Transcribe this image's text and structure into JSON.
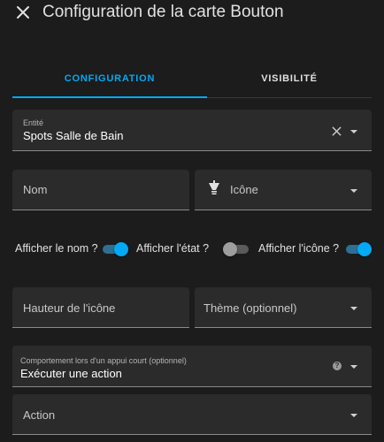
{
  "header": {
    "title": "Configuration de la carte Bouton",
    "close_icon": "close-icon"
  },
  "tabs": [
    {
      "label": "CONFIGURATION",
      "active": true
    },
    {
      "label": "VISIBILITÉ",
      "active": false
    }
  ],
  "entity_field": {
    "label": "Entité",
    "value": "Spots Salle de Bain"
  },
  "name_field": {
    "placeholder": "Nom"
  },
  "icon_field": {
    "placeholder": "Icône",
    "icon": "ceiling-light-icon"
  },
  "toggles": [
    {
      "label": "Afficher le nom ?",
      "on": true
    },
    {
      "label": "Afficher l'état ?",
      "on": false
    },
    {
      "label": "Afficher l'icône ?",
      "on": true
    }
  ],
  "icon_height_field": {
    "placeholder": "Hauteur de l'icône"
  },
  "theme_field": {
    "placeholder": "Thème (optionnel)"
  },
  "tap_action_field": {
    "label": "Comportement lors d'un appui court (optionnel)",
    "value": "Exécuter une action",
    "help_icon": "help-icon"
  },
  "action_field": {
    "placeholder": "Action"
  },
  "colors": {
    "accent": "#03a9f4",
    "background": "#1c1c1c",
    "field": "#2b2b2b"
  }
}
